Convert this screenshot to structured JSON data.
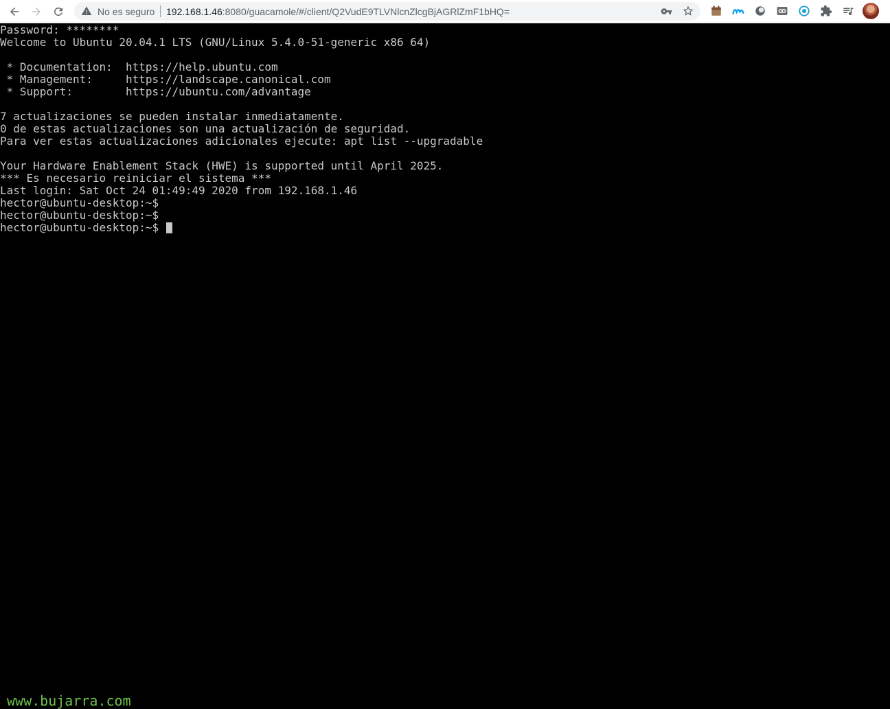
{
  "browser": {
    "security_label": "No es seguro",
    "url_host": "192.168.1.46",
    "url_rest": ":8080/guacamole/#/client/Q2VudE9TLVNlcnZlcgBjAGRlZmF1bHQ=",
    "icons": {
      "back": "arrow-left-icon",
      "forward": "arrow-right-icon",
      "reload": "reload-icon",
      "warning": "warning-triangle-icon",
      "password": "key-icon",
      "bookmark": "star-icon",
      "extensions": [
        "calendar-extension-icon",
        "movistar-extension-icon",
        "circle-extension-icon",
        "vpn-extension-icon",
        "wordpress-extension-icon",
        "puzzle-extensions-icon",
        "media-queue-icon",
        "profile-avatar"
      ]
    }
  },
  "terminal": {
    "lines": [
      "Password: ********",
      "Welcome to Ubuntu 20.04.1 LTS (GNU/Linux 5.4.0-51-generic x86 64)",
      "",
      " * Documentation:  https://help.ubuntu.com",
      " * Management:     https://landscape.canonical.com",
      " * Support:        https://ubuntu.com/advantage",
      "",
      "7 actualizaciones se pueden instalar inmediatamente.",
      "0 de estas actualizaciones son una actualización de seguridad.",
      "Para ver estas actualizaciones adicionales ejecute: apt list --upgradable",
      "",
      "Your Hardware Enablement Stack (HWE) is supported until April 2025.",
      "*** Es necesario reiniciar el sistema ***",
      "Last login: Sat Oct 24 01:49:49 2020 from 192.168.1.46",
      "hector@ubuntu-desktop:~$",
      "hector@ubuntu-desktop:~$",
      "hector@ubuntu-desktop:~$ "
    ]
  },
  "watermark": "www.bujarra.com",
  "colors": {
    "terminal_bg": "#000000",
    "terminal_fg": "#c8c8c8",
    "watermark": "#6cc04a"
  }
}
